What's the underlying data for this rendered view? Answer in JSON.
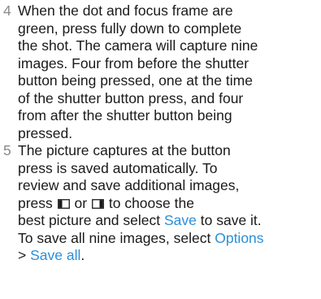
{
  "steps": [
    {
      "number": "4",
      "lines": [
        "When the dot and focus frame are",
        "green, press fully down to complete",
        "the shot. The camera will capture nine",
        "images. Four from before the shutter",
        "button being pressed, one at the time",
        "of the shutter button press, and four",
        "from after the shutter button being",
        "pressed."
      ]
    },
    {
      "number": "5",
      "line1": "The picture captures at the button",
      "line2": "press is saved automatically. To",
      "line3": "review and save additional images,",
      "line4_press": "press",
      "line4_or": "or",
      "line4_rest": "to choose the",
      "line5_pre": "best picture and select",
      "line5_link": "Save",
      "line5_post": "to save it.",
      "line6_pre": "To save all nine images, select",
      "line6_link": "Options",
      "line7_gt": ">",
      "line7_link": "Save all",
      "line7_post": "."
    }
  ],
  "icons": {
    "left_key": "left-selection-key-icon",
    "right_key": "right-selection-key-icon"
  },
  "colors": {
    "text": "#1a1a1a",
    "number": "#8a8a8a",
    "link": "#2a8fd8"
  }
}
